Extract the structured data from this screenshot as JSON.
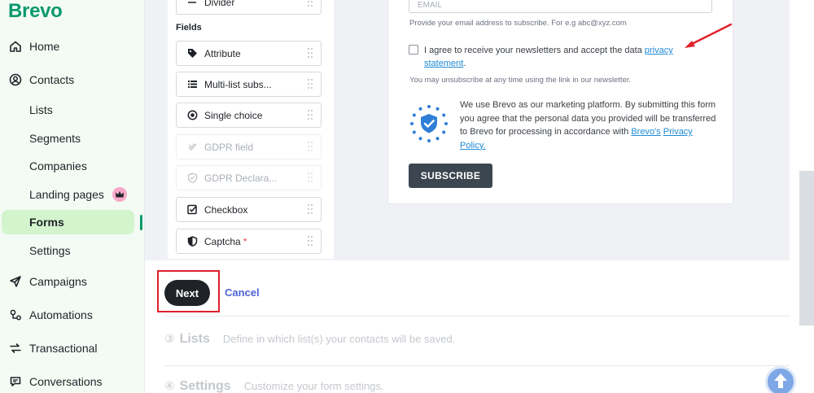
{
  "brand": {
    "logo": "Brevo",
    "accent": "#0b996e"
  },
  "sidebar": {
    "items": [
      {
        "label": "Home",
        "icon": "home-icon"
      },
      {
        "label": "Contacts",
        "icon": "contacts-icon"
      },
      {
        "label": "Lists"
      },
      {
        "label": "Segments"
      },
      {
        "label": "Companies"
      },
      {
        "label": "Landing pages",
        "badge_icon": "crown-icon"
      },
      {
        "label": "Forms",
        "active": true
      },
      {
        "label": "Settings"
      },
      {
        "label": "Campaigns",
        "icon": "paper-plane-icon"
      },
      {
        "label": "Automations",
        "icon": "automations-icon"
      },
      {
        "label": "Transactional",
        "icon": "transactional-icon"
      },
      {
        "label": "Conversations",
        "icon": "chat-icon"
      }
    ]
  },
  "palette": {
    "top_item": "Divider",
    "fields_heading": "Fields",
    "fields": [
      {
        "label": "Attribute",
        "icon": "tag-icon"
      },
      {
        "label": "Multi-list subs...",
        "icon": "list-icon"
      },
      {
        "label": "Single choice",
        "icon": "radio-icon"
      },
      {
        "label": "GDPR field",
        "icon": "gdpr-check-icon",
        "disabled": true
      },
      {
        "label": "GDPR Declara...",
        "icon": "shield-check-icon",
        "disabled": true
      },
      {
        "label": "Checkbox",
        "icon": "checkbox-icon"
      },
      {
        "label": "Captcha",
        "icon": "shield-icon",
        "required_mark": "*"
      }
    ]
  },
  "preview": {
    "email_placeholder": "EMAIL",
    "email_hint": "Provide your email address to subscribe. For e.g abc@xyz.com",
    "agree_text": "I agree to receive your newsletters and accept the data",
    "agree_link_1": "privacy",
    "agree_link_2": "statement",
    "agree_end": ".",
    "unsubscribe_hint": "You may unsubscribe at any time using the link in our newsletter.",
    "brevo_text": "We use Brevo as our marketing platform. By submitting this form you agree that the personal data you provided will be transferred to Brevo for processing in accordance with",
    "brevo_link_1": "Brevo's",
    "brevo_link_2": "Privacy Policy.",
    "subscribe_label": "SUBSCRIBE"
  },
  "actions": {
    "next_label": "Next",
    "cancel_label": "Cancel"
  },
  "steps": [
    {
      "number": "③",
      "title": "Lists",
      "desc": "Define in which list(s) your contacts will be saved."
    },
    {
      "number": "④",
      "title": "Settings",
      "desc": "Customize your form settings."
    }
  ],
  "annotation_colors": {
    "arrow": "#e0202b",
    "highlight_box": "#e0202b"
  }
}
